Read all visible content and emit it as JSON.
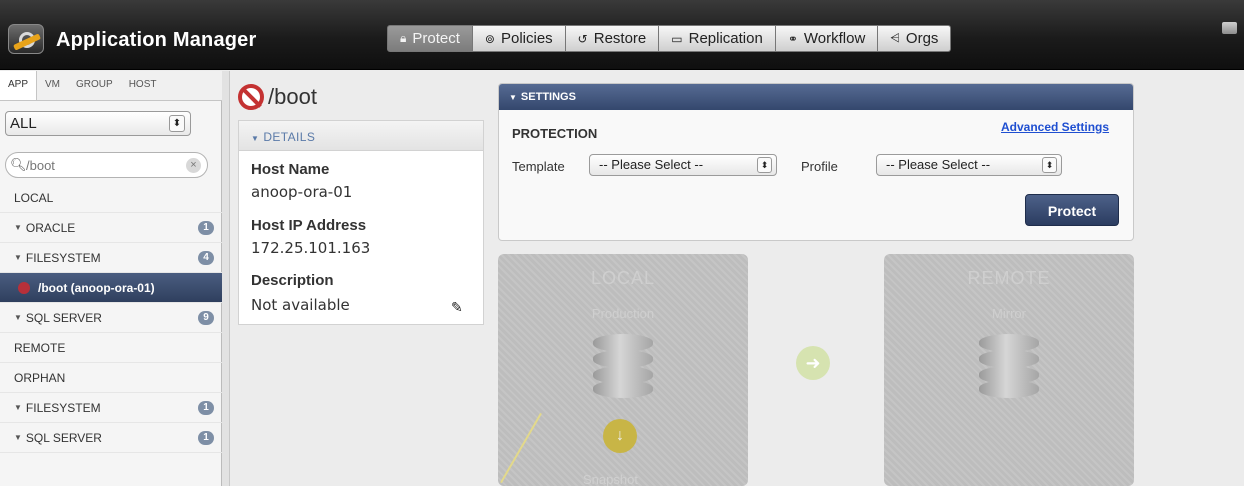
{
  "app": {
    "title": "Application Manager"
  },
  "nav": {
    "tabs": [
      {
        "label": "Protect",
        "icon": "lock-icon",
        "active": true
      },
      {
        "label": "Policies",
        "icon": "policies-icon"
      },
      {
        "label": "Restore",
        "icon": "restore-icon"
      },
      {
        "label": "Replication",
        "icon": "replication-icon"
      },
      {
        "label": "Workflow",
        "icon": "workflow-icon"
      },
      {
        "label": "Orgs",
        "icon": "orgs-icon"
      }
    ]
  },
  "sidebar": {
    "tabs": [
      "APP",
      "VM",
      "GROUP",
      "HOST"
    ],
    "filter": {
      "value": "ALL"
    },
    "search": {
      "value": "/boot"
    },
    "tree": [
      {
        "label": "LOCAL"
      },
      {
        "label": "ORACLE",
        "badge": "1",
        "expandable": true
      },
      {
        "label": "FILESYSTEM",
        "badge": "4",
        "expandable": true
      },
      {
        "label": "/boot (anoop-ora-01)",
        "selected": true
      },
      {
        "label": "SQL SERVER",
        "badge": "9",
        "expandable": true
      },
      {
        "label": "REMOTE"
      },
      {
        "label": "ORPHAN"
      },
      {
        "label": "FILESYSTEM",
        "badge": "1",
        "expandable": true
      },
      {
        "label": "SQL SERVER",
        "badge": "1",
        "expandable": true
      }
    ]
  },
  "details": {
    "title": "/boot",
    "section": "DETAILS",
    "host_name_label": "Host Name",
    "host_name": "anoop-ora-01",
    "host_ip_label": "Host IP Address",
    "host_ip": "172.25.101.163",
    "description_label": "Description",
    "description": "Not available"
  },
  "settings": {
    "section": "SETTINGS",
    "protection_label": "PROTECTION",
    "advanced_link": "Advanced Settings",
    "template_label": "Template",
    "template_value": "-- Please Select --",
    "profile_label": "Profile",
    "profile_value": "-- Please Select --",
    "protect_button": "Protect"
  },
  "topology": {
    "local_title": "LOCAL",
    "local_sub": "Production",
    "remote_title": "REMOTE",
    "remote_sub": "Mirror",
    "snapshot_label": "Snapshot"
  }
}
